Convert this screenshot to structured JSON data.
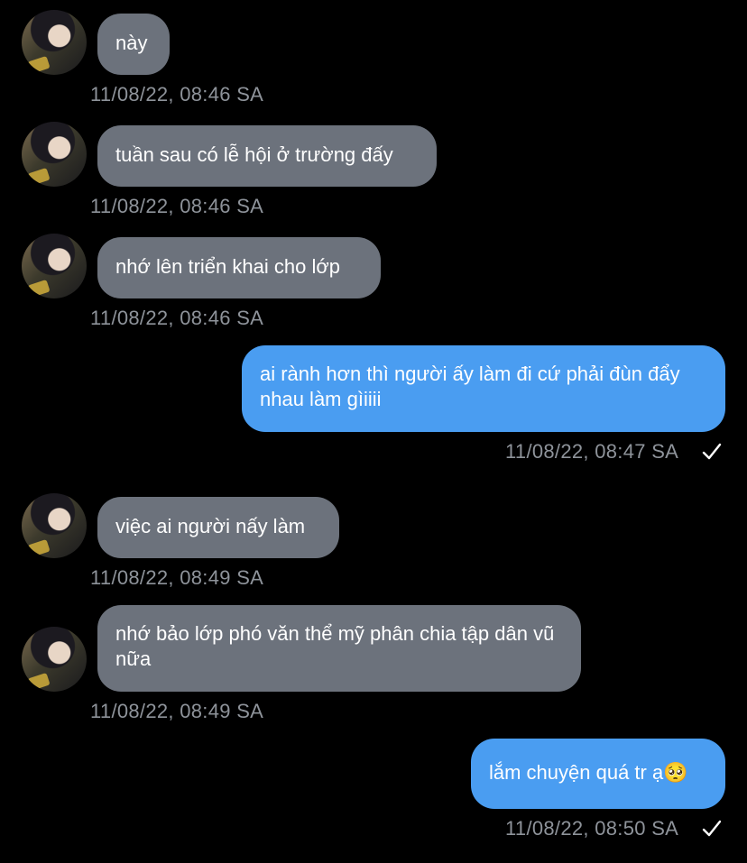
{
  "messages": [
    {
      "dir": "in",
      "text": "này",
      "time": "11/08/22, 08:46 SA"
    },
    {
      "dir": "in",
      "text": "tuần sau có lễ hội ở trường đấy",
      "time": "11/08/22, 08:46 SA"
    },
    {
      "dir": "in",
      "text": "nhớ lên triển khai cho lớp",
      "time": "11/08/22, 08:46 SA"
    },
    {
      "dir": "out",
      "text": "ai rành hơn thì người ấy làm đi cứ phải đùn đẩy nhau làm gìiiii",
      "time": "11/08/22, 08:47 SA"
    },
    {
      "dir": "in",
      "text": "việc ai người nấy làm",
      "time": "11/08/22, 08:49 SA"
    },
    {
      "dir": "in",
      "text": "nhớ bảo lớp phó văn thể mỹ phân chia tập dân vũ nữa",
      "time": "11/08/22, 08:49 SA"
    },
    {
      "dir": "out",
      "text": "lắm chuyện quá tr ạ🥺",
      "time": "11/08/22, 08:50 SA"
    }
  ]
}
